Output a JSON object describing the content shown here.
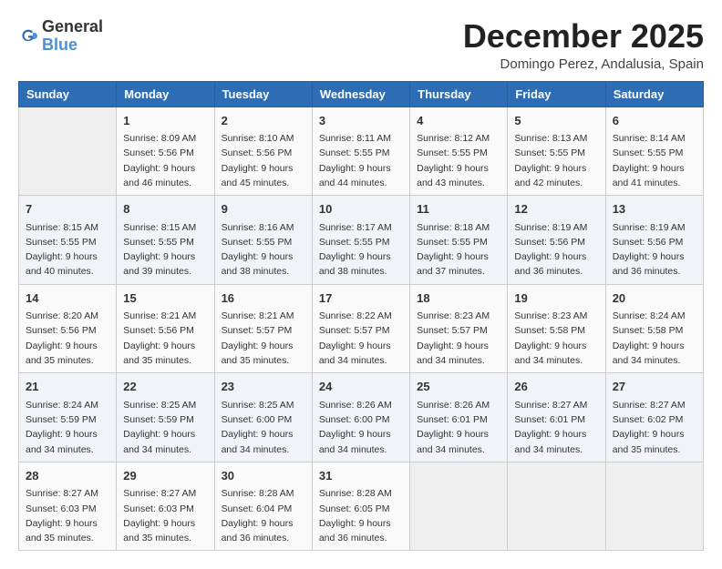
{
  "logo": {
    "general": "General",
    "blue": "Blue"
  },
  "title": {
    "month_year": "December 2025",
    "location": "Domingo Perez, Andalusia, Spain"
  },
  "weekdays": [
    "Sunday",
    "Monday",
    "Tuesday",
    "Wednesday",
    "Thursday",
    "Friday",
    "Saturday"
  ],
  "weeks": [
    [
      {
        "day": "",
        "info": ""
      },
      {
        "day": "1",
        "info": "Sunrise: 8:09 AM\nSunset: 5:56 PM\nDaylight: 9 hours\nand 46 minutes."
      },
      {
        "day": "2",
        "info": "Sunrise: 8:10 AM\nSunset: 5:56 PM\nDaylight: 9 hours\nand 45 minutes."
      },
      {
        "day": "3",
        "info": "Sunrise: 8:11 AM\nSunset: 5:55 PM\nDaylight: 9 hours\nand 44 minutes."
      },
      {
        "day": "4",
        "info": "Sunrise: 8:12 AM\nSunset: 5:55 PM\nDaylight: 9 hours\nand 43 minutes."
      },
      {
        "day": "5",
        "info": "Sunrise: 8:13 AM\nSunset: 5:55 PM\nDaylight: 9 hours\nand 42 minutes."
      },
      {
        "day": "6",
        "info": "Sunrise: 8:14 AM\nSunset: 5:55 PM\nDaylight: 9 hours\nand 41 minutes."
      }
    ],
    [
      {
        "day": "7",
        "info": "Sunrise: 8:15 AM\nSunset: 5:55 PM\nDaylight: 9 hours\nand 40 minutes."
      },
      {
        "day": "8",
        "info": "Sunrise: 8:15 AM\nSunset: 5:55 PM\nDaylight: 9 hours\nand 39 minutes."
      },
      {
        "day": "9",
        "info": "Sunrise: 8:16 AM\nSunset: 5:55 PM\nDaylight: 9 hours\nand 38 minutes."
      },
      {
        "day": "10",
        "info": "Sunrise: 8:17 AM\nSunset: 5:55 PM\nDaylight: 9 hours\nand 38 minutes."
      },
      {
        "day": "11",
        "info": "Sunrise: 8:18 AM\nSunset: 5:55 PM\nDaylight: 9 hours\nand 37 minutes."
      },
      {
        "day": "12",
        "info": "Sunrise: 8:19 AM\nSunset: 5:56 PM\nDaylight: 9 hours\nand 36 minutes."
      },
      {
        "day": "13",
        "info": "Sunrise: 8:19 AM\nSunset: 5:56 PM\nDaylight: 9 hours\nand 36 minutes."
      }
    ],
    [
      {
        "day": "14",
        "info": "Sunrise: 8:20 AM\nSunset: 5:56 PM\nDaylight: 9 hours\nand 35 minutes."
      },
      {
        "day": "15",
        "info": "Sunrise: 8:21 AM\nSunset: 5:56 PM\nDaylight: 9 hours\nand 35 minutes."
      },
      {
        "day": "16",
        "info": "Sunrise: 8:21 AM\nSunset: 5:57 PM\nDaylight: 9 hours\nand 35 minutes."
      },
      {
        "day": "17",
        "info": "Sunrise: 8:22 AM\nSunset: 5:57 PM\nDaylight: 9 hours\nand 34 minutes."
      },
      {
        "day": "18",
        "info": "Sunrise: 8:23 AM\nSunset: 5:57 PM\nDaylight: 9 hours\nand 34 minutes."
      },
      {
        "day": "19",
        "info": "Sunrise: 8:23 AM\nSunset: 5:58 PM\nDaylight: 9 hours\nand 34 minutes."
      },
      {
        "day": "20",
        "info": "Sunrise: 8:24 AM\nSunset: 5:58 PM\nDaylight: 9 hours\nand 34 minutes."
      }
    ],
    [
      {
        "day": "21",
        "info": "Sunrise: 8:24 AM\nSunset: 5:59 PM\nDaylight: 9 hours\nand 34 minutes."
      },
      {
        "day": "22",
        "info": "Sunrise: 8:25 AM\nSunset: 5:59 PM\nDaylight: 9 hours\nand 34 minutes."
      },
      {
        "day": "23",
        "info": "Sunrise: 8:25 AM\nSunset: 6:00 PM\nDaylight: 9 hours\nand 34 minutes."
      },
      {
        "day": "24",
        "info": "Sunrise: 8:26 AM\nSunset: 6:00 PM\nDaylight: 9 hours\nand 34 minutes."
      },
      {
        "day": "25",
        "info": "Sunrise: 8:26 AM\nSunset: 6:01 PM\nDaylight: 9 hours\nand 34 minutes."
      },
      {
        "day": "26",
        "info": "Sunrise: 8:27 AM\nSunset: 6:01 PM\nDaylight: 9 hours\nand 34 minutes."
      },
      {
        "day": "27",
        "info": "Sunrise: 8:27 AM\nSunset: 6:02 PM\nDaylight: 9 hours\nand 35 minutes."
      }
    ],
    [
      {
        "day": "28",
        "info": "Sunrise: 8:27 AM\nSunset: 6:03 PM\nDaylight: 9 hours\nand 35 minutes."
      },
      {
        "day": "29",
        "info": "Sunrise: 8:27 AM\nSunset: 6:03 PM\nDaylight: 9 hours\nand 35 minutes."
      },
      {
        "day": "30",
        "info": "Sunrise: 8:28 AM\nSunset: 6:04 PM\nDaylight: 9 hours\nand 36 minutes."
      },
      {
        "day": "31",
        "info": "Sunrise: 8:28 AM\nSunset: 6:05 PM\nDaylight: 9 hours\nand 36 minutes."
      },
      {
        "day": "",
        "info": ""
      },
      {
        "day": "",
        "info": ""
      },
      {
        "day": "",
        "info": ""
      }
    ]
  ]
}
